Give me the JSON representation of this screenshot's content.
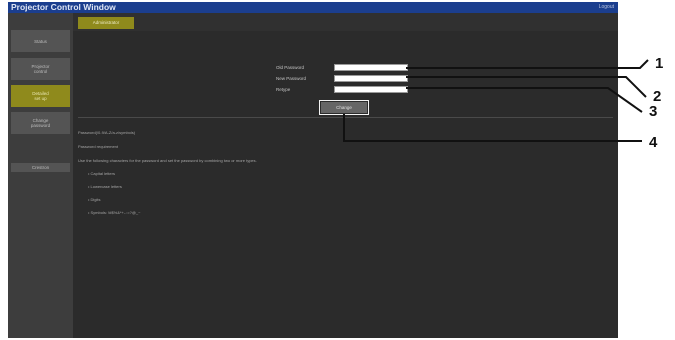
{
  "window": {
    "title": "Projector Control Window",
    "logout_label": "Logout"
  },
  "sidebar": {
    "items": [
      {
        "label": "Status"
      },
      {
        "label": "Projector\ncontrol"
      },
      {
        "label": "Detailed\nset up"
      },
      {
        "label": "Change\npassword"
      },
      {
        "label": "Crestron"
      }
    ]
  },
  "tabs": [
    {
      "label": "Administrator"
    }
  ],
  "form": {
    "old_label": "Old Password",
    "new_label": "New Password",
    "retype_label": "Retype",
    "old_value": "",
    "new_value": "",
    "retype_value": "",
    "change_label": "Change"
  },
  "notes": [
    "Password(/0-9/A-Z/a-z/symbols)",
    "Password requirement",
    "Use the following characters for the password and set the password by combining two or more types.",
    "• Capital letters",
    "• Lowercase letters",
    "• Digits",
    "• Symbols: !#$%&*+-.:=?@_~"
  ],
  "callouts": {
    "c1": "1",
    "c2": "2",
    "c3": "3",
    "c4": "4"
  },
  "colors": {
    "title_bar": "#1b3e8e",
    "accent": "#8f8a1c",
    "panel": "#2b2b2b"
  }
}
